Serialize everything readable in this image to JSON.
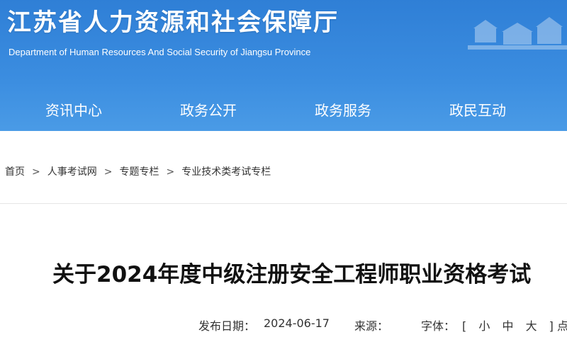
{
  "header": {
    "title": "江苏省人力资源和社会保障厅",
    "subtitle": "Department of Human Resources And Social Security of Jiangsu Province"
  },
  "nav": {
    "items": [
      {
        "label": "资讯中心"
      },
      {
        "label": "政务公开"
      },
      {
        "label": "政务服务"
      },
      {
        "label": "政民互动"
      }
    ]
  },
  "breadcrumb": {
    "items": [
      "首页",
      "人事考试网",
      "专题专栏",
      "专业技术类考试专栏"
    ],
    "separator": ">"
  },
  "article": {
    "title": "关于2024年度中级注册安全工程师职业资格考试",
    "publish_label": "发布日期：",
    "publish_date": "2024-06-17",
    "source_label": "来源：",
    "font_label": "字体：",
    "font_open": "[",
    "font_small": "小",
    "font_medium": "中",
    "font_large": "大",
    "font_close": "]",
    "trailing": "点"
  },
  "colors": {
    "header_bg": "#3b8de0",
    "nav_text": "#ffffff"
  }
}
